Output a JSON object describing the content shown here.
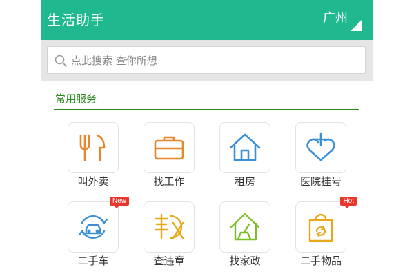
{
  "header": {
    "title": "生活助手",
    "city": "广州",
    "bg_color": "#20b88e"
  },
  "search": {
    "placeholder": "点此搜索 查你所想",
    "value": ""
  },
  "section": {
    "title": "常用服务",
    "accent_color": "#2c8a1e"
  },
  "services": [
    {
      "label": "叫外卖",
      "icon": "fork-knife-icon",
      "color": "#e8862a"
    },
    {
      "label": "找工作",
      "icon": "briefcase-icon",
      "color": "#e8862a"
    },
    {
      "label": "租房",
      "icon": "house-icon",
      "color": "#3b8fd4"
    },
    {
      "label": "医院挂号",
      "icon": "heart-cross-icon",
      "color": "#3b8fd4"
    },
    {
      "label": "二手车",
      "icon": "car-cycle-icon",
      "color": "#3b8fd4",
      "badge": "New"
    },
    {
      "label": "查违章",
      "icon": "violation-stamp-icon",
      "color": "#e8a81a"
    },
    {
      "label": "找家政",
      "icon": "broom-house-icon",
      "color": "#7cbf2a"
    },
    {
      "label": "二手物品",
      "icon": "recycle-bag-icon",
      "color": "#e8a81a",
      "badge": "Hot"
    }
  ]
}
